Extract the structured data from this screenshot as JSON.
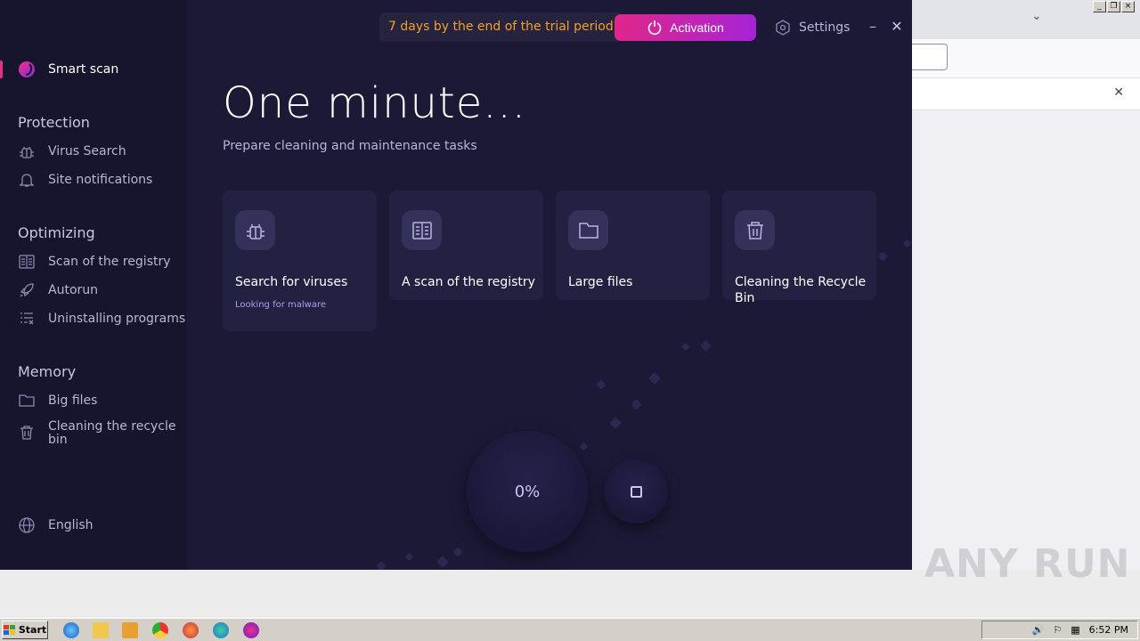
{
  "header": {
    "trial_text": "7 days by the end of the trial period",
    "activation_label": "Activation",
    "settings_label": "Settings"
  },
  "sidebar": {
    "smart_scan": "Smart scan",
    "sections": {
      "protection": "Protection",
      "optimizing": "Optimizing",
      "memory": "Memory"
    },
    "items": {
      "virus_search": "Virus Search",
      "site_notifications": "Site notifications",
      "registry_scan": "Scan of the registry",
      "autorun": "Autorun",
      "uninstalling": "Uninstalling programs",
      "big_files": "Big files",
      "recycle_line1": "Cleaning the recycle",
      "recycle_line2": "bin"
    },
    "language": "English"
  },
  "main": {
    "title": "One minute...",
    "subtitle": "Prepare cleaning and maintenance tasks",
    "cards": [
      {
        "label": "Search for viruses",
        "status": "Looking for malware",
        "icon": "bug-icon"
      },
      {
        "label": "A scan of the registry",
        "icon": "registry-icon"
      },
      {
        "label": "Large files",
        "icon": "folder-icon"
      },
      {
        "label": "Cleaning the Recycle Bin",
        "icon": "trash-icon"
      }
    ],
    "progress": "0%"
  },
  "taskbar": {
    "start_label": "Start",
    "clock": "6:52 PM"
  },
  "watermark": "ANY RUN",
  "colors": {
    "accent_pink": "#e0268a",
    "accent_purple": "#a624d6",
    "trial_orange": "#f0a030",
    "app_bg": "#1b1936"
  }
}
